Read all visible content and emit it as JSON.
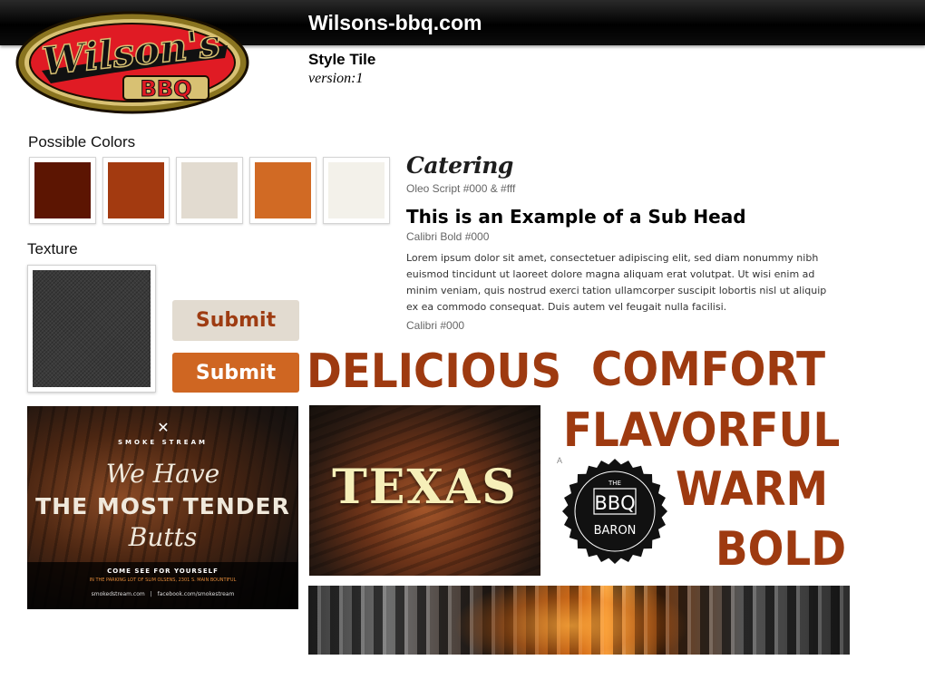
{
  "header": {
    "site_title": "Wilsons-bbq.com"
  },
  "logo": {
    "line1": "Wilson's",
    "line2": "BBQ"
  },
  "tile": {
    "title": "Style Tile",
    "version": "version:1"
  },
  "colors": {
    "label": "Possible Colors",
    "swatches": [
      "#5c1502",
      "#a33a10",
      "#e2dbd0",
      "#d16a24",
      "#f3f1ea"
    ]
  },
  "texture": {
    "label": "Texture"
  },
  "buttons": {
    "primary_label": "Submit",
    "secondary_label": "Submit"
  },
  "typography": {
    "heading": "Catering",
    "heading_note": "Oleo Script #000 & #fff",
    "subhead": "This is an Example of a Sub Head",
    "subhead_note": "Calibri Bold #000",
    "body": "Lorem ipsum dolor sit amet, consectetuer adipiscing elit, sed diam nonummy nibh euismod tincidunt ut laoreet dolore magna aliquam erat volutpat. Ut wisi enim ad minim veniam, quis nostrud exerci tation ullamcorper suscipit lobortis nisl ut aliquip ex ea commodo consequat. Duis autem vel feugait nulla facilisi.",
    "body_note": "Calibri #000"
  },
  "adjectives": [
    "DELICIOUS",
    "COMFORT",
    "FLAVORFUL",
    "WARM",
    "BOLD"
  ],
  "brisket_ad": {
    "brand": "SMOKE STREAM",
    "script1": "We Have",
    "headline": "THE MOST TENDER",
    "script2": "Butts",
    "cta": "COME SEE FOR YOURSELF",
    "location": "IN THE PARKING LOT OF SLIM OLSENS, 2301 S. MAIN BOUNTIFUL",
    "site": "smokedstream.com",
    "social": "facebook.com/smokestream"
  },
  "texas_photo": {
    "text": "TEXAS"
  },
  "badge": {
    "small": "THE",
    "line1": "BBQ",
    "line2": "BARON"
  },
  "misc": {
    "tiny_letter": "A"
  }
}
